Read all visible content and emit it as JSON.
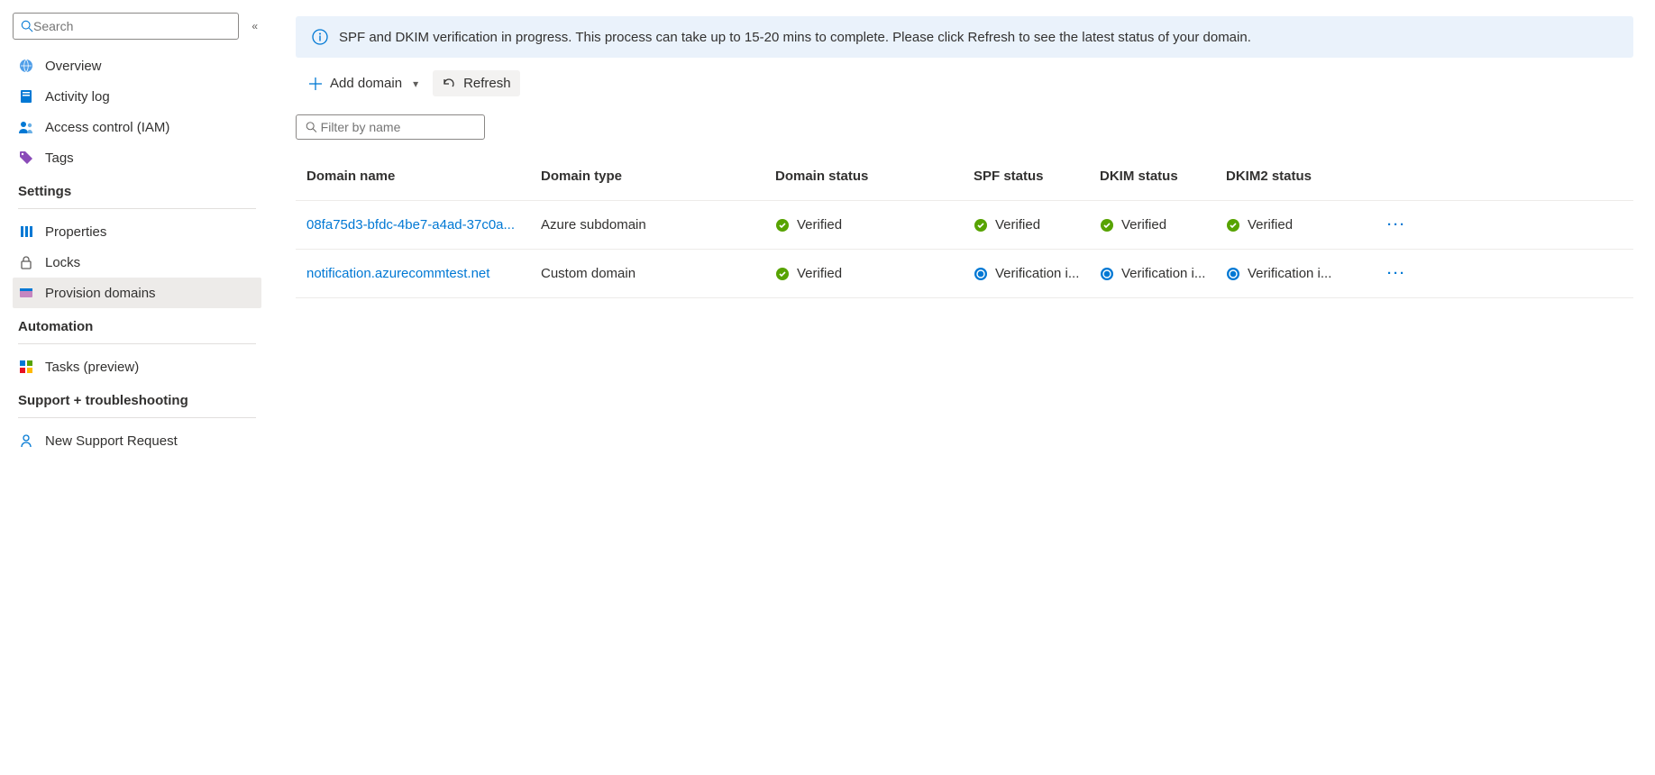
{
  "sidebar": {
    "search_placeholder": "Search",
    "top_items": [
      {
        "label": "Overview",
        "icon": "world-icon"
      },
      {
        "label": "Activity log",
        "icon": "book-icon"
      },
      {
        "label": "Access control (IAM)",
        "icon": "people-icon"
      },
      {
        "label": "Tags",
        "icon": "tag-icon"
      }
    ],
    "sections": [
      {
        "title": "Settings",
        "items": [
          {
            "label": "Properties",
            "icon": "properties-icon"
          },
          {
            "label": "Locks",
            "icon": "lock-icon"
          },
          {
            "label": "Provision domains",
            "icon": "domain-icon",
            "active": true
          }
        ]
      },
      {
        "title": "Automation",
        "items": [
          {
            "label": "Tasks (preview)",
            "icon": "tasks-icon"
          }
        ]
      },
      {
        "title": "Support + troubleshooting",
        "items": [
          {
            "label": "New Support Request",
            "icon": "support-icon"
          }
        ]
      }
    ]
  },
  "banner": {
    "text": "SPF and DKIM verification in progress. This process can take up to 15-20 mins to complete. Please click Refresh to see the latest status of your domain."
  },
  "toolbar": {
    "add_domain_label": "Add domain",
    "refresh_label": "Refresh"
  },
  "filter": {
    "placeholder": "Filter by name"
  },
  "table": {
    "columns": [
      "Domain name",
      "Domain type",
      "Domain status",
      "SPF status",
      "DKIM status",
      "DKIM2 status"
    ],
    "rows": [
      {
        "domain_name": "08fa75d3-bfdc-4be7-a4ad-37c0a...",
        "domain_type": "Azure subdomain",
        "domain_status": {
          "text": "Verified",
          "state": "verified"
        },
        "spf_status": {
          "text": "Verified",
          "state": "verified"
        },
        "dkim_status": {
          "text": "Verified",
          "state": "verified"
        },
        "dkim2_status": {
          "text": "Verified",
          "state": "verified"
        }
      },
      {
        "domain_name": "notification.azurecommtest.net",
        "domain_type": "Custom domain",
        "domain_status": {
          "text": "Verified",
          "state": "verified"
        },
        "spf_status": {
          "text": "Verification i...",
          "state": "inprogress"
        },
        "dkim_status": {
          "text": "Verification i...",
          "state": "inprogress"
        },
        "dkim2_status": {
          "text": "Verification i...",
          "state": "inprogress"
        }
      }
    ]
  }
}
